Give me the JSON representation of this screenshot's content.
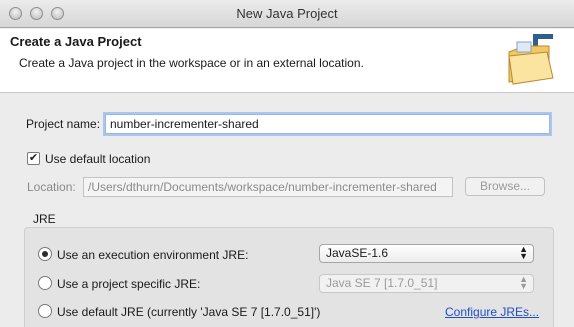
{
  "window": {
    "title": "New Java Project"
  },
  "header": {
    "title": "Create a Java Project",
    "description": "Create a Java project in the workspace or in an external location."
  },
  "project": {
    "name_label": "Project name:",
    "name_value": "number-incrementer-shared"
  },
  "location": {
    "use_default_label": "Use default location",
    "use_default_checked": true,
    "label": "Location:",
    "value": "/Users/dthurn/Documents/workspace/number-incrementer-shared",
    "browse_label": "Browse..."
  },
  "jre": {
    "group_label": "JRE",
    "option_env_label": "Use an execution environment JRE:",
    "option_env_value": "JavaSE-1.6",
    "option_specific_label": "Use a project specific JRE:",
    "option_specific_value": "Java SE 7 [1.7.0_51]",
    "option_default_label": "Use default JRE (currently 'Java SE 7 [1.7.0_51]')",
    "configure_link": "Configure JREs...",
    "selected": "env"
  }
}
